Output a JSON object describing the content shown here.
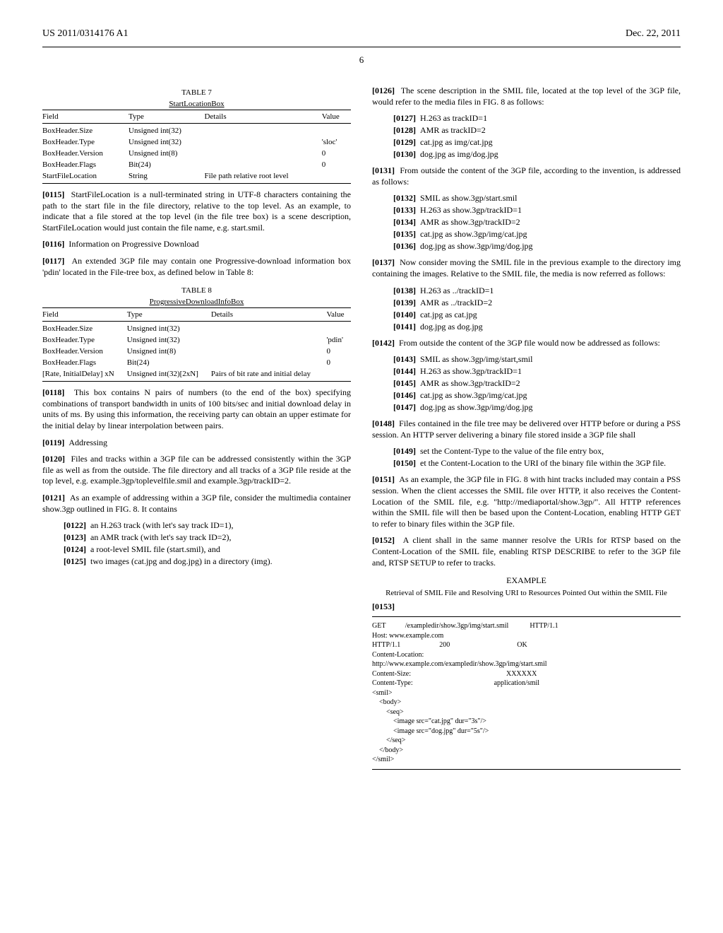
{
  "header": {
    "pub_no": "US 2011/0314176 A1",
    "date": "Dec. 22, 2011",
    "page_no": "6"
  },
  "table7": {
    "title": "TABLE 7",
    "subtitle": "StartLocationBox",
    "headers": [
      "Field",
      "Type",
      "Details",
      "Value"
    ],
    "rows": [
      [
        "BoxHeader.Size",
        "Unsigned int(32)",
        "",
        ""
      ],
      [
        "BoxHeader.Type",
        "Unsigned int(32)",
        "",
        "'sloc'"
      ],
      [
        "BoxHeader.Version",
        "Unsigned int(8)",
        "",
        "0"
      ],
      [
        "BoxHeader.Flags",
        "Bit(24)",
        "",
        "0"
      ],
      [
        "StartFileLocation",
        "String",
        "File path relative root level",
        ""
      ]
    ]
  },
  "p0115": "StartFileLocation is a null-terminated string in UTF-8 characters containing the path to the start file in the file directory, relative to the top level. As an example, to indicate that a file stored at the top level (in the file tree box) is a scene description, StartFileLocation would just contain the file name, e.g. start.smil.",
  "p0116": "Information on Progressive Download",
  "p0117": "An extended 3GP file may contain one Progressive-download information box 'pdin' located in the File-tree box, as defined below in Table 8:",
  "table8": {
    "title": "TABLE 8",
    "subtitle": "ProgressiveDownloadInfoBox",
    "headers": [
      "Field",
      "Type",
      "Details",
      "Value"
    ],
    "rows": [
      [
        "BoxHeader.Size",
        "Unsigned int(32)",
        "",
        ""
      ],
      [
        "BoxHeader.Type",
        "Unsigned int(32)",
        "",
        "'pdin'"
      ],
      [
        "BoxHeader.Version",
        "Unsigned int(8)",
        "",
        "0"
      ],
      [
        "BoxHeader.Flags",
        "Bit(24)",
        "",
        "0"
      ],
      [
        "[Rate, InitialDelay] xN",
        "Unsigned int(32)[2xN]",
        "Pairs of bit rate and initial delay",
        ""
      ]
    ]
  },
  "p0118": "This box contains N pairs of numbers (to the end of the box) specifying combinations of transport bandwidth in units of 100 bits/sec and initial download delay in units of ms. By using this information, the receiving party can obtain an upper estimate for the initial delay by linear interpolation between pairs.",
  "p0119": "Addressing",
  "p0120": "Files and tracks within a 3GP file can be addressed consistently within the 3GP file as well as from the outside. The file directory and all tracks of a 3GP file reside at the top level, e.g. example.3gp/toplevelfile.smil and example.3gp/trackID=2.",
  "p0121": "As an example of addressing within a 3GP file, consider the multimedia container show.3gp outlined in FIG. 8. It contains",
  "p0122": "an H.263 track (with let's say track ID=1),",
  "p0123": "an AMR track (with let's say track ID=2),",
  "p0124": "a root-level SMIL file (start.smil), and",
  "p0125": "two images (cat.jpg and dog.jpg) in a directory (img).",
  "p0126": "The scene description in the SMIL file, located at the top level of the 3GP file, would refer to the media files in FIG. 8 as follows:",
  "p0127": "H.263 as trackID=1",
  "p0128": "AMR as trackID=2",
  "p0129": "cat.jpg as img/cat.jpg",
  "p0130": "dog.jpg as img/dog.jpg",
  "p0131": "From outside the content of the 3GP file, according to the invention, is addressed as follows:",
  "p0132": "SMIL as show.3gp/start.smil",
  "p0133": "H.263 as show.3gp/trackID=1",
  "p0134": "AMR as show.3gp/trackID=2",
  "p0135": "cat.jpg as show.3gp/img/cat.jpg",
  "p0136": "dog.jpg as show.3gp/img/dog.jpg",
  "p0137": "Now consider moving the SMIL file in the previous example to the directory img containing the images. Relative to the SMIL file, the media is now referred as follows:",
  "p0138": "H.263 as ../trackID=1",
  "p0139": "AMR as ../trackID=2",
  "p0140": "cat.jpg as cat.jpg",
  "p0141": "dog.jpg as dog.jpg",
  "p0142": "From outside the content of the 3GP file would now be addressed as follows:",
  "p0143": "SMIL as show.3gp/img/start,smil",
  "p0144": "H.263 as show.3gp/trackID=1",
  "p0145": "AMR as show.3gp/trackID=2",
  "p0146": "cat.jpg as show.3gp/img/cat.jpg",
  "p0147": "dog.jpg as show.3gp/img/dog.jpg",
  "p0148": "Files contained in the file tree may be delivered over HTTP before or during a PSS session. An HTTP server delivering a binary file stored inside a 3GP file shall",
  "p0149": "set the Content-Type to the value of the file entry box,",
  "p0150": "et the Content-Location to the URI of the binary file within the 3GP file.",
  "p0151": "As an example, the 3GP file in FIG. 8 with hint tracks included may contain a PSS session. When the client accesses the SMIL file over HTTP, it also receives the Content-Location of the SMIL file, e.g. \"http://mediaportal/show.3gp/\". All HTTP references within the SMIL file will then be based upon the Content-Location, enabling HTTP GET to refer to binary files within the 3GP file.",
  "p0152": "A client shall in the same manner resolve the URIs for RTSP based on the Content-Location of the SMIL file, enabling RTSP DESCRIBE to refer to the 3GP file and, RTSP SETUP to refer to tracks.",
  "example_heading": "EXAMPLE",
  "example_sub": "Retrieval of SMIL File and Resolving URI to Resources Pointed Out within the SMIL File",
  "p0153": "[0153]",
  "code": "GET           /exampledir/show.3gp/img/start.smil            HTTP/1.1\nHost: www.example.com\nHTTP/1.1                      200                                      OK\nContent-Location:\nhttp://www.example.com/exampledir/show.3gp/img/start.smil\nContent-Size:                                                      XXXXXX\nContent-Type:                                              application/smil\n<smil>\n    <body>\n        <seq>\n            <image src=\"cat.jpg\" dur=\"3s\"/>\n            <image src=\"dog.jpg\" dur=\"5s\"/>\n        </seq>\n    </body>\n</smil>"
}
